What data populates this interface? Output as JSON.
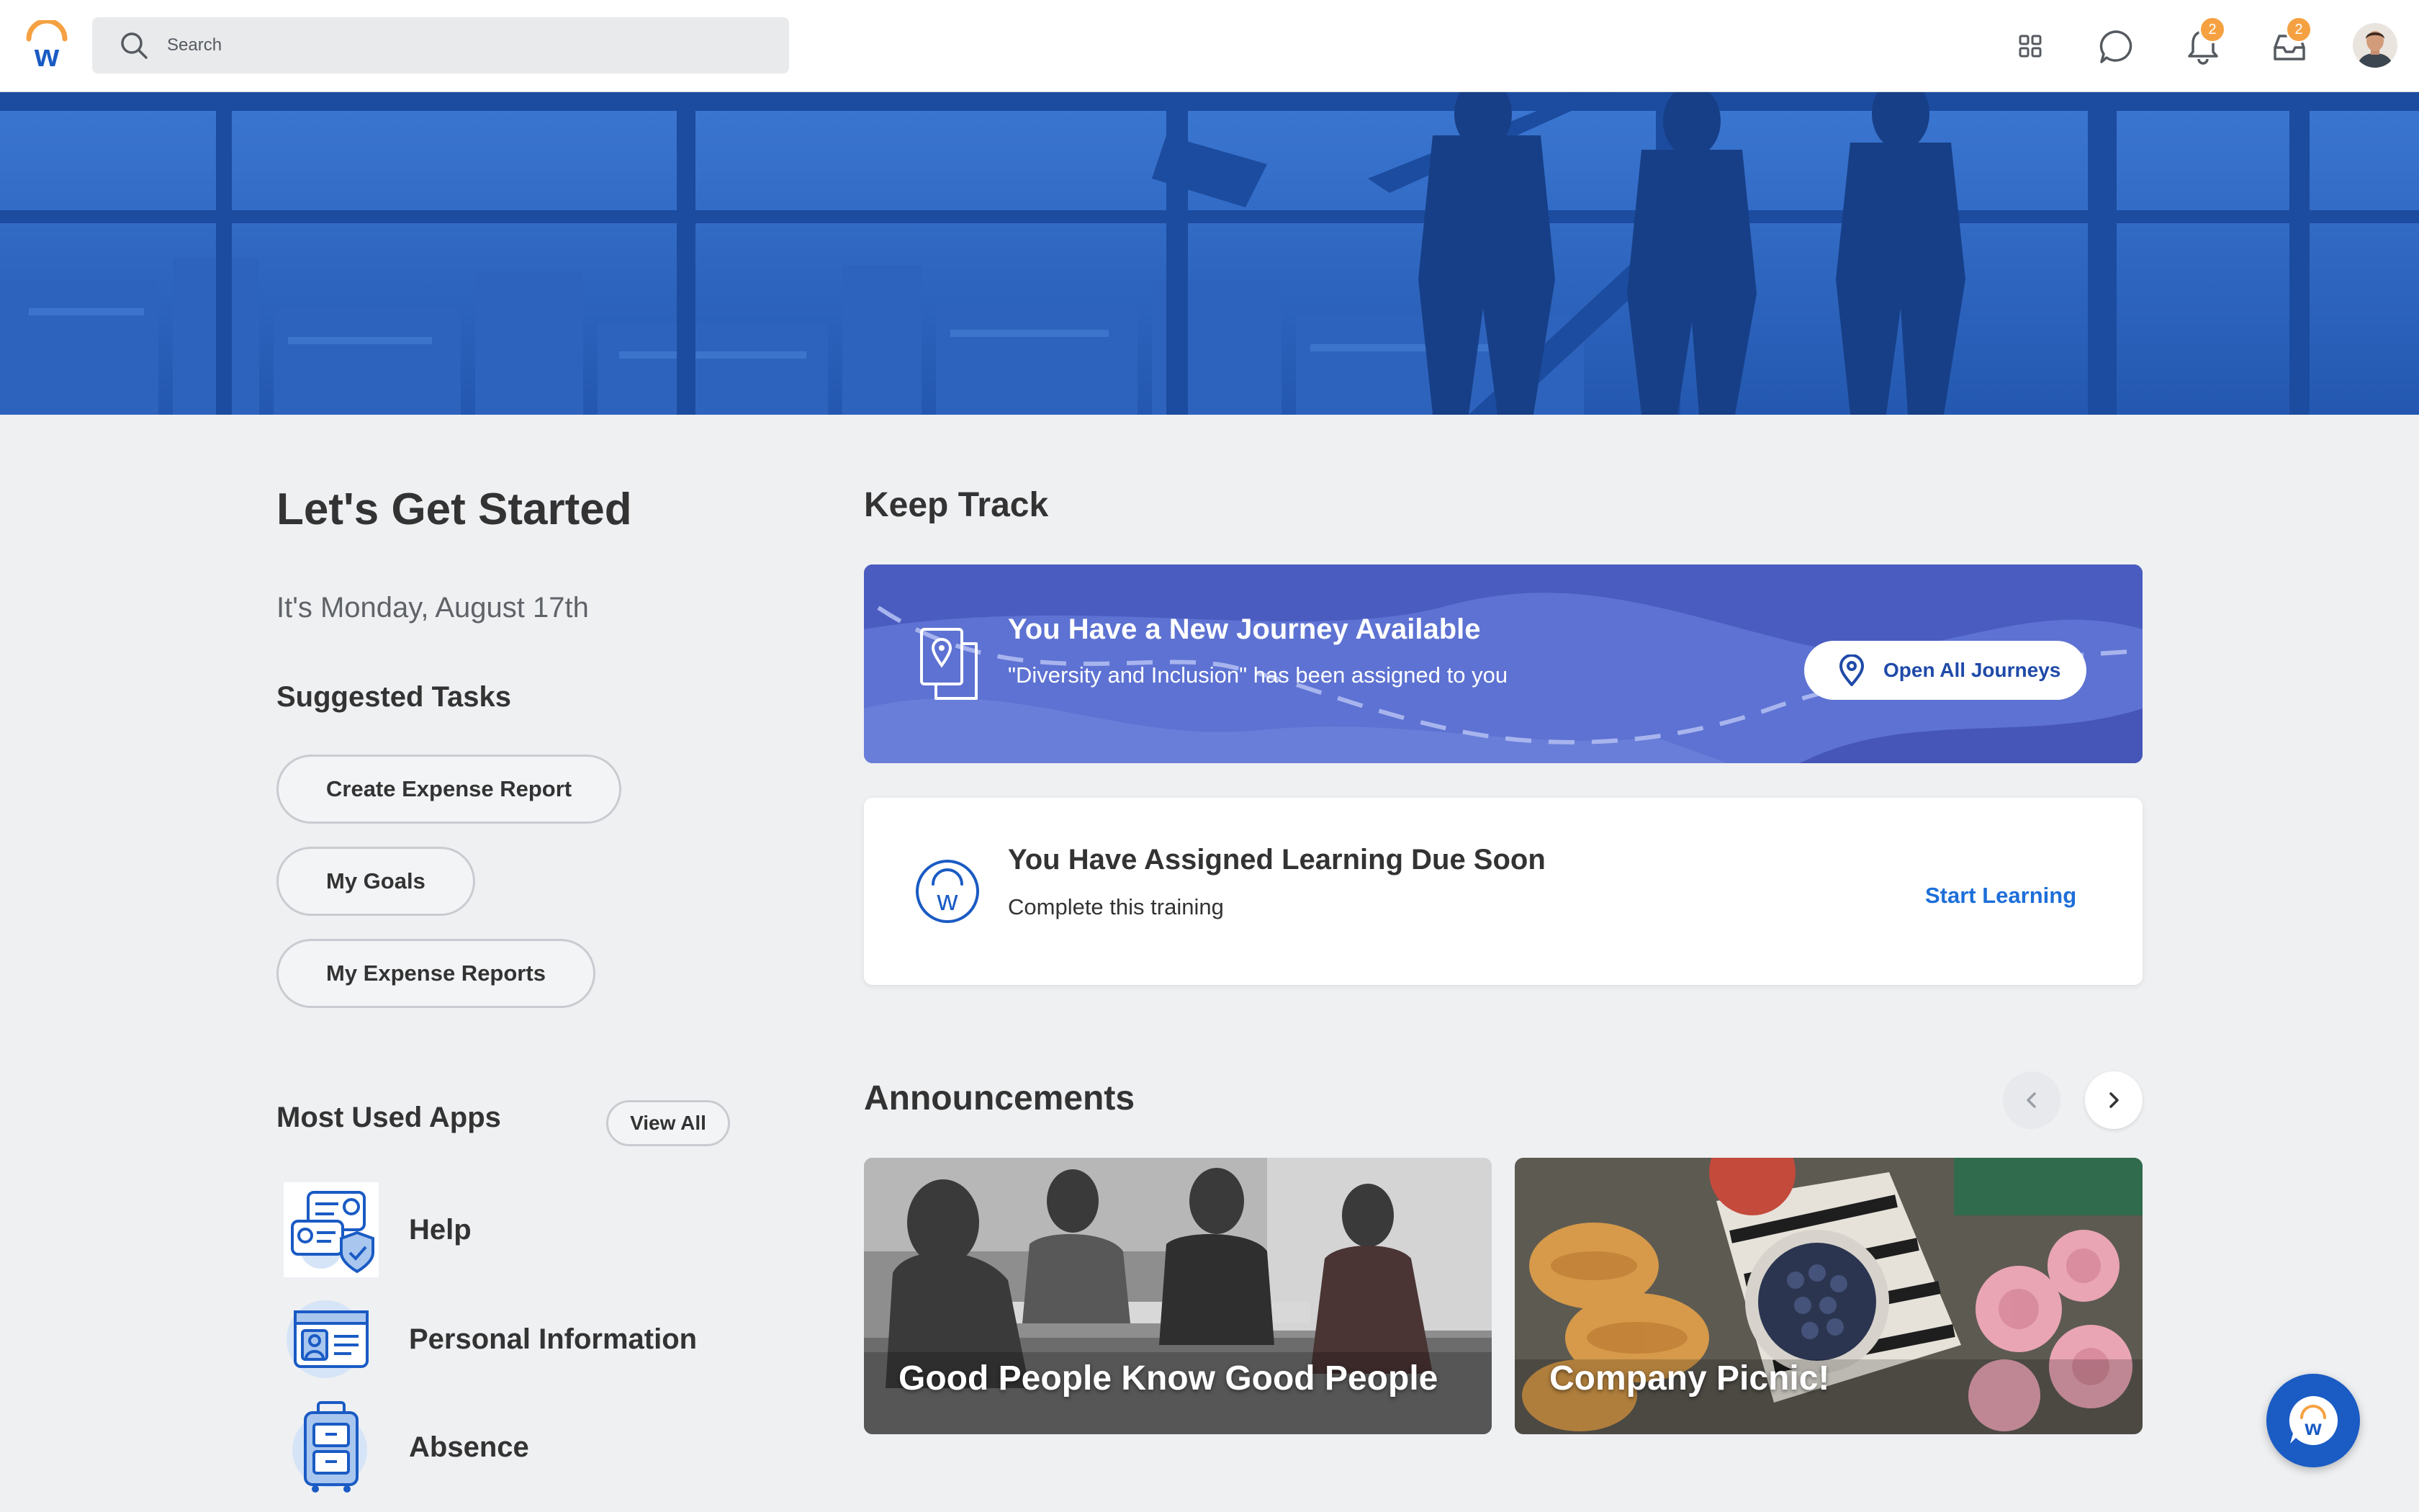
{
  "topbar": {
    "search_placeholder": "Search",
    "notifications_count": "2",
    "inbox_count": "2"
  },
  "left": {
    "title": "Let's Get Started",
    "date": "It's Monday, August 17th",
    "suggested_heading": "Suggested Tasks",
    "tasks": [
      "Create Expense Report",
      "My Goals",
      "My Expense Reports"
    ],
    "apps_heading": "Most Used Apps",
    "view_all": "View All",
    "apps": [
      "Help",
      "Personal Information",
      "Absence"
    ]
  },
  "keep_track": {
    "heading": "Keep Track",
    "journey": {
      "title": "You Have a New Journey Available",
      "subtitle": "\"Diversity and Inclusion\" has been assigned to you",
      "button": "Open All Journeys"
    },
    "learning": {
      "title": "You Have Assigned Learning Due Soon",
      "subtitle": "Complete this training",
      "link": "Start Learning"
    }
  },
  "announcements": {
    "heading": "Announcements",
    "cards": [
      "Good People Know Good People",
      "Company Picnic!"
    ]
  },
  "colors": {
    "brand_blue": "#1a5bc4",
    "hero_blue": "#2a67c6",
    "journey_purple": "#5a6fcc",
    "link_blue": "#1e6fd9",
    "badge_orange": "#f5a142",
    "page_bg": "#eff0f2"
  },
  "icons": [
    "workday-logo-icon",
    "search-icon",
    "apps-grid-icon",
    "chat-icon",
    "bell-icon",
    "inbox-icon",
    "map-pin-icon",
    "journey-map-icon",
    "workday-learning-icon",
    "chevron-left-icon",
    "chevron-right-icon",
    "help-app-icon",
    "personal-info-app-icon",
    "absence-app-icon"
  ]
}
